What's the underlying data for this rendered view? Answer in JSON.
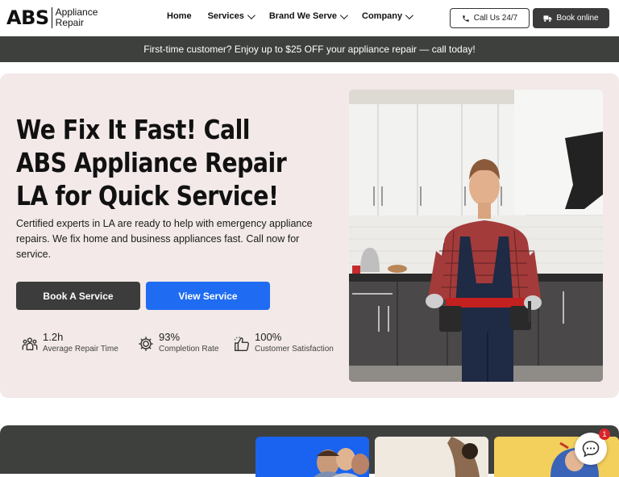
{
  "header": {
    "logo": {
      "abs": "ABS",
      "line1": "Appliance",
      "line2": "Repair"
    },
    "nav": [
      {
        "label": "Home",
        "has_dropdown": false
      },
      {
        "label": "Services",
        "has_dropdown": true
      },
      {
        "label": "Brand We Serve",
        "has_dropdown": true
      },
      {
        "label": "Company",
        "has_dropdown": true
      }
    ],
    "call_button": "Call Us 24/7",
    "book_button": "Book online"
  },
  "promo": {
    "text": "First-time customer? Enjoy up to $25 OFF your appliance repair — call today!"
  },
  "hero": {
    "title": "We Fix It Fast! Call ABS Appliance Repair LA for Quick Service!",
    "description": "Certified experts in LA are ready to help with emergency appliance repairs. We fix home and business appliances fast. Call now for service.",
    "primary_button": "Book A Service",
    "secondary_button": "View Service",
    "stats": [
      {
        "value": "1.2h",
        "label": "Average Repair Time",
        "icon": "team-icon"
      },
      {
        "value": "93%",
        "label": "Completion Rate",
        "icon": "gear-icon"
      },
      {
        "value": "100%",
        "label": "Customer Satisfaction",
        "icon": "thumbs-up-icon"
      }
    ]
  },
  "chat": {
    "badge_count": "1"
  },
  "colors": {
    "primary_dark": "#3c3c3c",
    "accent_blue": "#1f6cf2",
    "hero_bg": "#f2e9e8",
    "promo_bg": "#3e403e",
    "badge_red": "#d9252a"
  }
}
